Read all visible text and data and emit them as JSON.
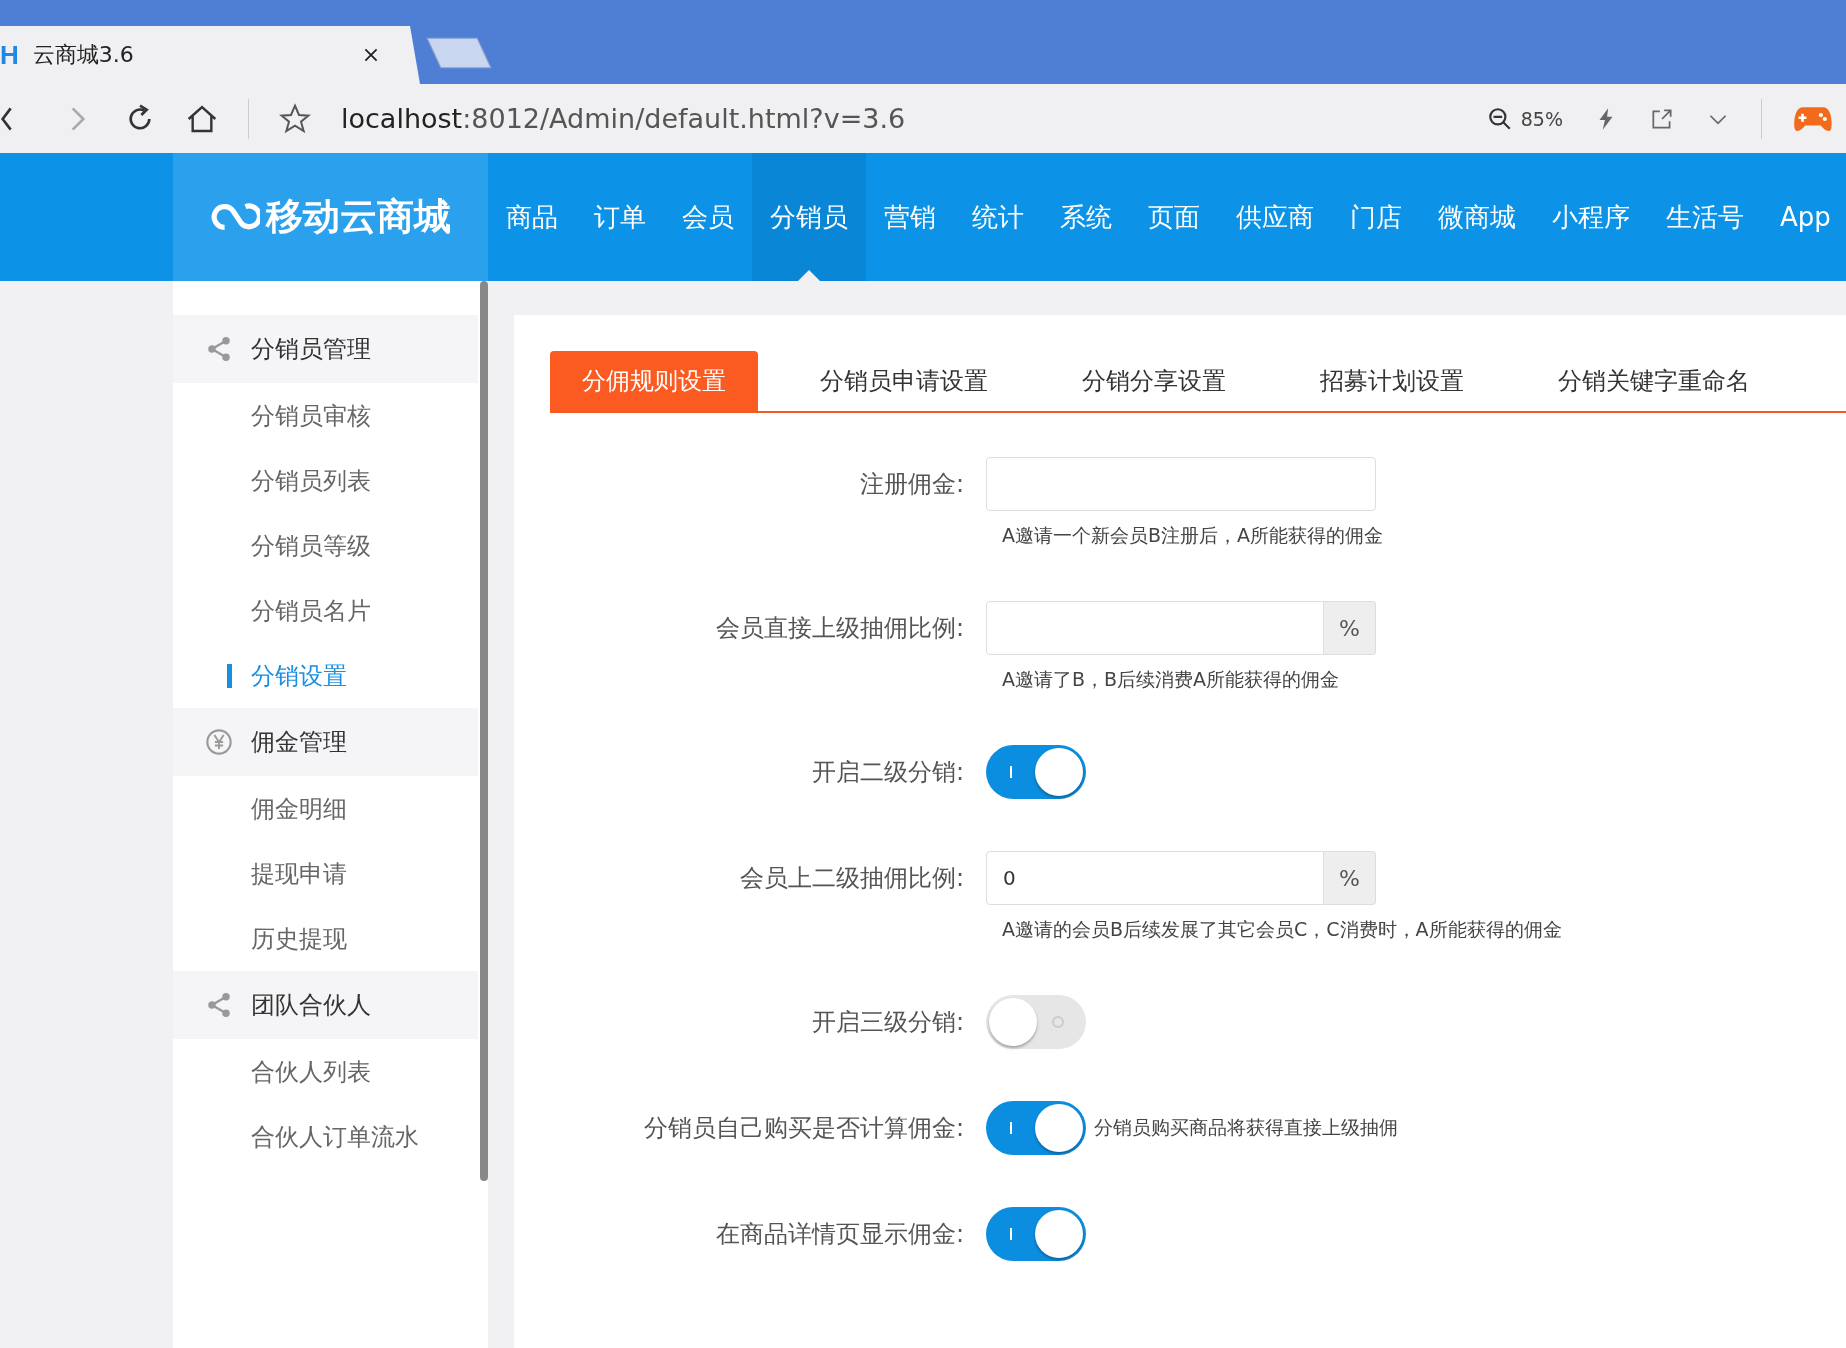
{
  "browser": {
    "favicon": "H",
    "tab_title": "云商城3.6",
    "url_host": "localhost",
    "url_rest": ":8012/Admin/default.html?v=3.6",
    "zoom": "85%"
  },
  "header": {
    "logo": "移动云商城",
    "nav": [
      {
        "label": "商品",
        "selected": false
      },
      {
        "label": "订单",
        "selected": false
      },
      {
        "label": "会员",
        "selected": false
      },
      {
        "label": "分销员",
        "selected": true
      },
      {
        "label": "营销",
        "selected": false
      },
      {
        "label": "统计",
        "selected": false
      },
      {
        "label": "系统",
        "selected": false
      },
      {
        "label": "页面",
        "selected": false
      },
      {
        "label": "供应商",
        "selected": false
      },
      {
        "label": "门店",
        "selected": false
      },
      {
        "label": "微商城",
        "selected": false
      },
      {
        "label": "小程序",
        "selected": false
      },
      {
        "label": "生活号",
        "selected": false
      },
      {
        "label": "App",
        "selected": false
      }
    ]
  },
  "sidebar": {
    "groups": [
      {
        "title": "分销员管理",
        "kind": "share",
        "items": [
          {
            "label": "分销员审核",
            "selected": false
          },
          {
            "label": "分销员列表",
            "selected": false
          },
          {
            "label": "分销员等级",
            "selected": false
          },
          {
            "label": "分销员名片",
            "selected": false
          },
          {
            "label": "分销设置",
            "selected": true
          }
        ]
      },
      {
        "title": "佣金管理",
        "kind": "yen",
        "items": [
          {
            "label": "佣金明细",
            "selected": false
          },
          {
            "label": "提现申请",
            "selected": false
          },
          {
            "label": "历史提现",
            "selected": false
          }
        ]
      },
      {
        "title": "团队合伙人",
        "kind": "share",
        "items": [
          {
            "label": "合伙人列表",
            "selected": false
          },
          {
            "label": "合伙人订单流水",
            "selected": false
          }
        ]
      }
    ]
  },
  "tabs": [
    {
      "label": "分佣规则设置",
      "selected": true
    },
    {
      "label": "分销员申请设置",
      "selected": false
    },
    {
      "label": "分销分享设置",
      "selected": false
    },
    {
      "label": "招募计划设置",
      "selected": false
    },
    {
      "label": "分销关键字重命名",
      "selected": false
    }
  ],
  "form": [
    {
      "kind": "input",
      "label": "注册佣金:",
      "hint": "A邀请一个新会员B注册后，A所能获得的佣金"
    },
    {
      "kind": "input",
      "label": "会员直接上级抽佣比例:",
      "suffix": "%",
      "hint": "A邀请了B，B后续消费A所能获得的佣金"
    },
    {
      "kind": "toggle",
      "label": "开启二级分销:",
      "on": true
    },
    {
      "kind": "input",
      "label": "会员上二级抽佣比例:",
      "value": "0",
      "suffix": "%",
      "hint": "A邀请的会员B后续发展了其它会员C，C消费时，A所能获得的佣金"
    },
    {
      "kind": "toggle",
      "label": "开启三级分销:",
      "on": false
    },
    {
      "kind": "toggle",
      "label": "分销员自己购买是否计算佣金:",
      "on": true,
      "note": "分销员购买商品将获得直接上级抽佣"
    },
    {
      "kind": "toggle",
      "label": "在商品详情页显示佣金:",
      "on": true
    }
  ]
}
